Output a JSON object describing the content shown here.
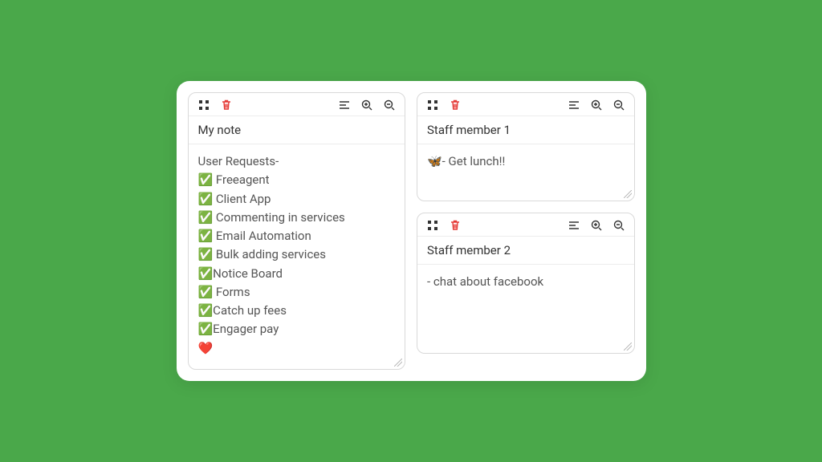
{
  "colors": {
    "background": "#4aa84a",
    "delete": "#e53935"
  },
  "notes": [
    {
      "title": "My note",
      "body": "User Requests-\n✅ Freeagent\n✅ Client App\n✅ Commenting in services\n✅ Email Automation\n✅ Bulk adding services\n✅Notice Board\n✅ Forms\n✅Catch up fees\n✅Engager pay\n❤️"
    },
    {
      "title": "Staff member 1",
      "body": "🦋- Get lunch!!"
    },
    {
      "title": "Staff member 2",
      "body": "- chat about facebook"
    }
  ]
}
